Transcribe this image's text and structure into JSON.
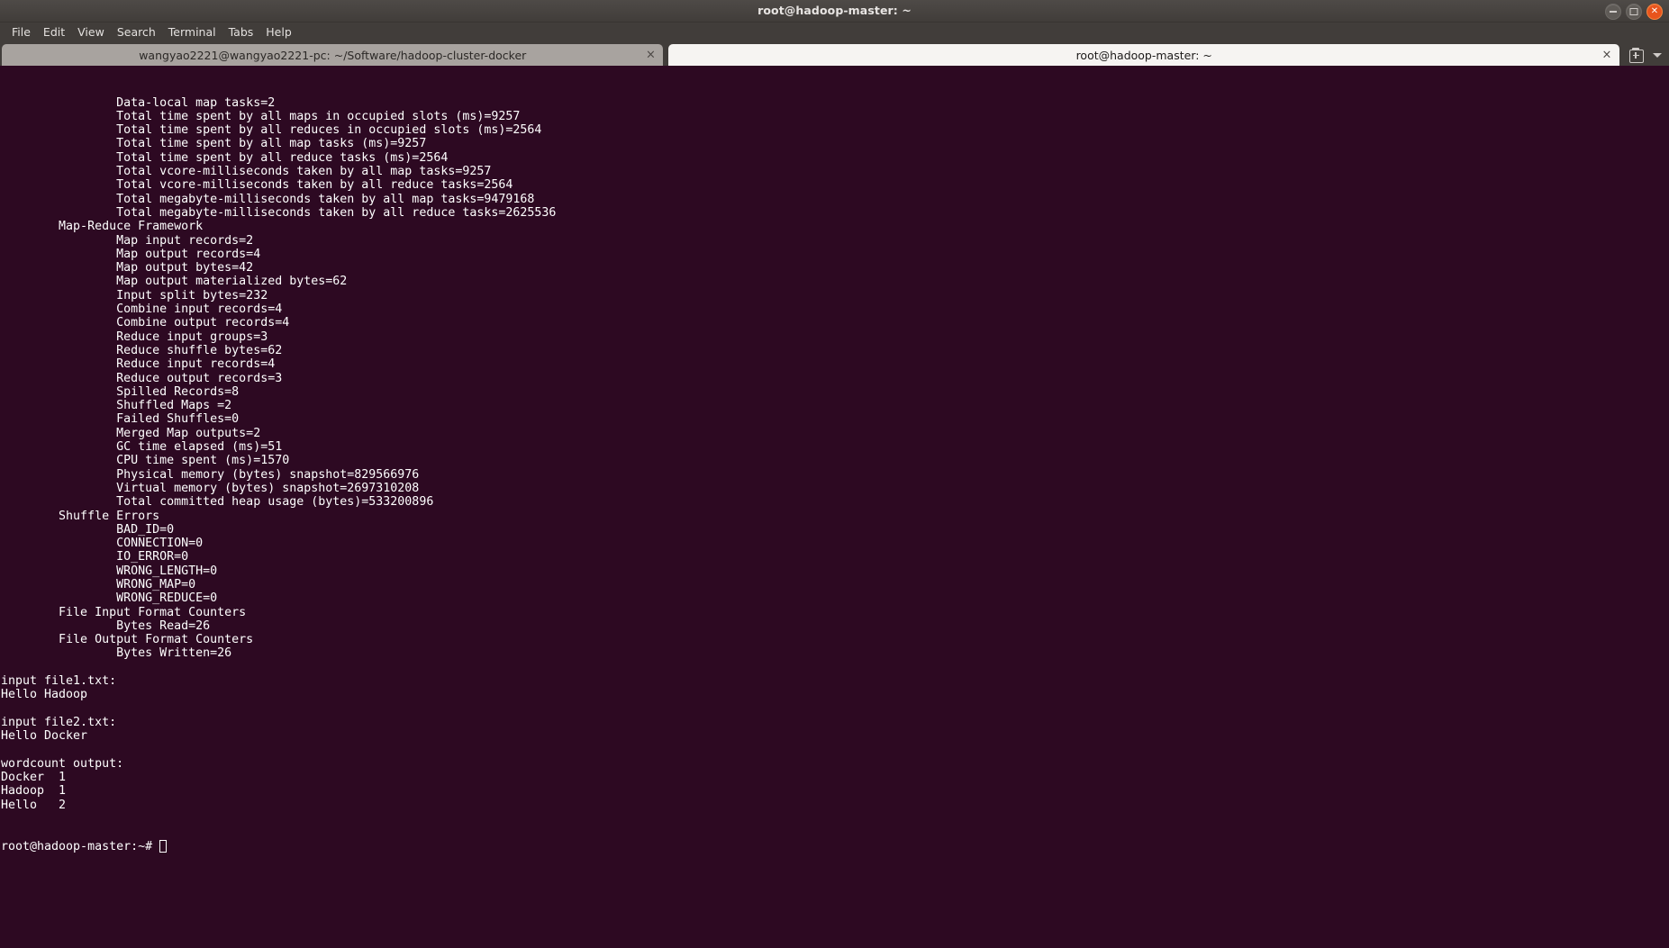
{
  "window": {
    "title": "root@hadoop-master: ~",
    "controls": [
      {
        "name": "minimize",
        "glyph": "–"
      },
      {
        "name": "maximize",
        "glyph": "□"
      },
      {
        "name": "close",
        "glyph": "✕"
      }
    ]
  },
  "menubar": {
    "items": [
      {
        "label": "File"
      },
      {
        "label": "Edit"
      },
      {
        "label": "View"
      },
      {
        "label": "Search"
      },
      {
        "label": "Terminal"
      },
      {
        "label": "Tabs"
      },
      {
        "label": "Help"
      }
    ]
  },
  "tabbar": {
    "tabs": [
      {
        "label": "wangyao2221@wangyao2221-pc: ~/Software/hadoop-cluster-docker",
        "active": false,
        "close_glyph": "×"
      },
      {
        "label": "root@hadoop-master: ~",
        "active": true,
        "close_glyph": "×"
      }
    ],
    "new_tab_icon": "new-tab-icon",
    "tab_list_icon": "chevron-down-icon"
  },
  "terminal": {
    "prompt": "root@hadoop-master:~# ",
    "lines": [
      "\t\tData-local map tasks=2",
      "\t\tTotal time spent by all maps in occupied slots (ms)=9257",
      "\t\tTotal time spent by all reduces in occupied slots (ms)=2564",
      "\t\tTotal time spent by all map tasks (ms)=9257",
      "\t\tTotal time spent by all reduce tasks (ms)=2564",
      "\t\tTotal vcore-milliseconds taken by all map tasks=9257",
      "\t\tTotal vcore-milliseconds taken by all reduce tasks=2564",
      "\t\tTotal megabyte-milliseconds taken by all map tasks=9479168",
      "\t\tTotal megabyte-milliseconds taken by all reduce tasks=2625536",
      "\tMap-Reduce Framework",
      "\t\tMap input records=2",
      "\t\tMap output records=4",
      "\t\tMap output bytes=42",
      "\t\tMap output materialized bytes=62",
      "\t\tInput split bytes=232",
      "\t\tCombine input records=4",
      "\t\tCombine output records=4",
      "\t\tReduce input groups=3",
      "\t\tReduce shuffle bytes=62",
      "\t\tReduce input records=4",
      "\t\tReduce output records=3",
      "\t\tSpilled Records=8",
      "\t\tShuffled Maps =2",
      "\t\tFailed Shuffles=0",
      "\t\tMerged Map outputs=2",
      "\t\tGC time elapsed (ms)=51",
      "\t\tCPU time spent (ms)=1570",
      "\t\tPhysical memory (bytes) snapshot=829566976",
      "\t\tVirtual memory (bytes) snapshot=2697310208",
      "\t\tTotal committed heap usage (bytes)=533200896",
      "\tShuffle Errors",
      "\t\tBAD_ID=0",
      "\t\tCONNECTION=0",
      "\t\tIO_ERROR=0",
      "\t\tWRONG_LENGTH=0",
      "\t\tWRONG_MAP=0",
      "\t\tWRONG_REDUCE=0",
      "\tFile Input Format Counters ",
      "\t\tBytes Read=26",
      "\tFile Output Format Counters ",
      "\t\tBytes Written=26",
      "",
      "input file1.txt:",
      "Hello Hadoop",
      "",
      "input file2.txt:",
      "Hello Docker",
      "",
      "wordcount output:",
      "Docker\t1",
      "Hadoop\t1",
      "Hello\t2"
    ]
  },
  "colors": {
    "terminal_bg": "#2d0922",
    "terminal_fg": "#ffffff",
    "titlebar_bg": "#413d3a",
    "close_button": "#e8541c",
    "active_tab_bg": "#f6f4f2",
    "inactive_tab_bg": "#a8a39f"
  }
}
